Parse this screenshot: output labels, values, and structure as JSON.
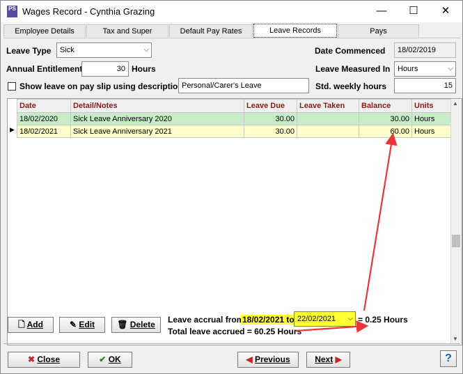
{
  "window": {
    "title": "Wages Record - Cynthia Grazing",
    "app_icon": "PS",
    "minimize": "—",
    "maximize": "☐",
    "close": "✕"
  },
  "tabs": [
    {
      "label": "Employee Details"
    },
    {
      "label": "Tax and Super"
    },
    {
      "label": "Default Pay Rates"
    },
    {
      "label": "Leave Records"
    },
    {
      "label": "Pays"
    }
  ],
  "form": {
    "leave_type_label": "Leave Type",
    "leave_type_value": "Sick",
    "annual_entitlement_label": "Annual Entitlement",
    "annual_entitlement_value": "30",
    "hours_label": "Hours",
    "show_leave_label": "Show leave on pay slip using description",
    "show_leave_checked": false,
    "description_value": "Personal/Carer's Leave",
    "date_commenced_label": "Date Commenced",
    "date_commenced_value": "18/02/2019",
    "leave_measured_label": "Leave Measured In",
    "leave_measured_value": "Hours",
    "std_weekly_label": "Std. weekly hours",
    "std_weekly_value": "15"
  },
  "grid": {
    "columns": [
      "Date",
      "Detail/Notes",
      "Leave Due",
      "Leave Taken",
      "Balance",
      "Units"
    ],
    "rows": [
      {
        "date": "18/02/2020",
        "detail": "Sick Leave Anniversary 2020",
        "due": "30.00",
        "taken": "",
        "balance": "30.00",
        "units": "Hours"
      },
      {
        "date": "18/02/2021",
        "detail": "Sick Leave Anniversary 2021",
        "due": "30.00",
        "taken": "",
        "balance": "60.00",
        "units": "Hours"
      }
    ],
    "current_row_indicator": "▶"
  },
  "actions": {
    "add": "Add",
    "edit": "Edit",
    "delete": "Delete"
  },
  "accrual": {
    "from_label": "Leave accrual from",
    "from_date": "18/02/2021",
    "to_label": "to",
    "to_date": "22/02/2021",
    "result": "= 0.25 Hours",
    "total_label": "Total leave accrued = 60.25 Hours"
  },
  "footer": {
    "close": "Close",
    "ok": "OK",
    "previous": "Previous",
    "next": "Next",
    "help": "?"
  },
  "colors": {
    "accent_red": "#e8363a",
    "header_text": "#8b1a1a",
    "row_green": "#c8ecc8",
    "row_yellow": "#ffffcc",
    "highlight": "#ffff33"
  }
}
